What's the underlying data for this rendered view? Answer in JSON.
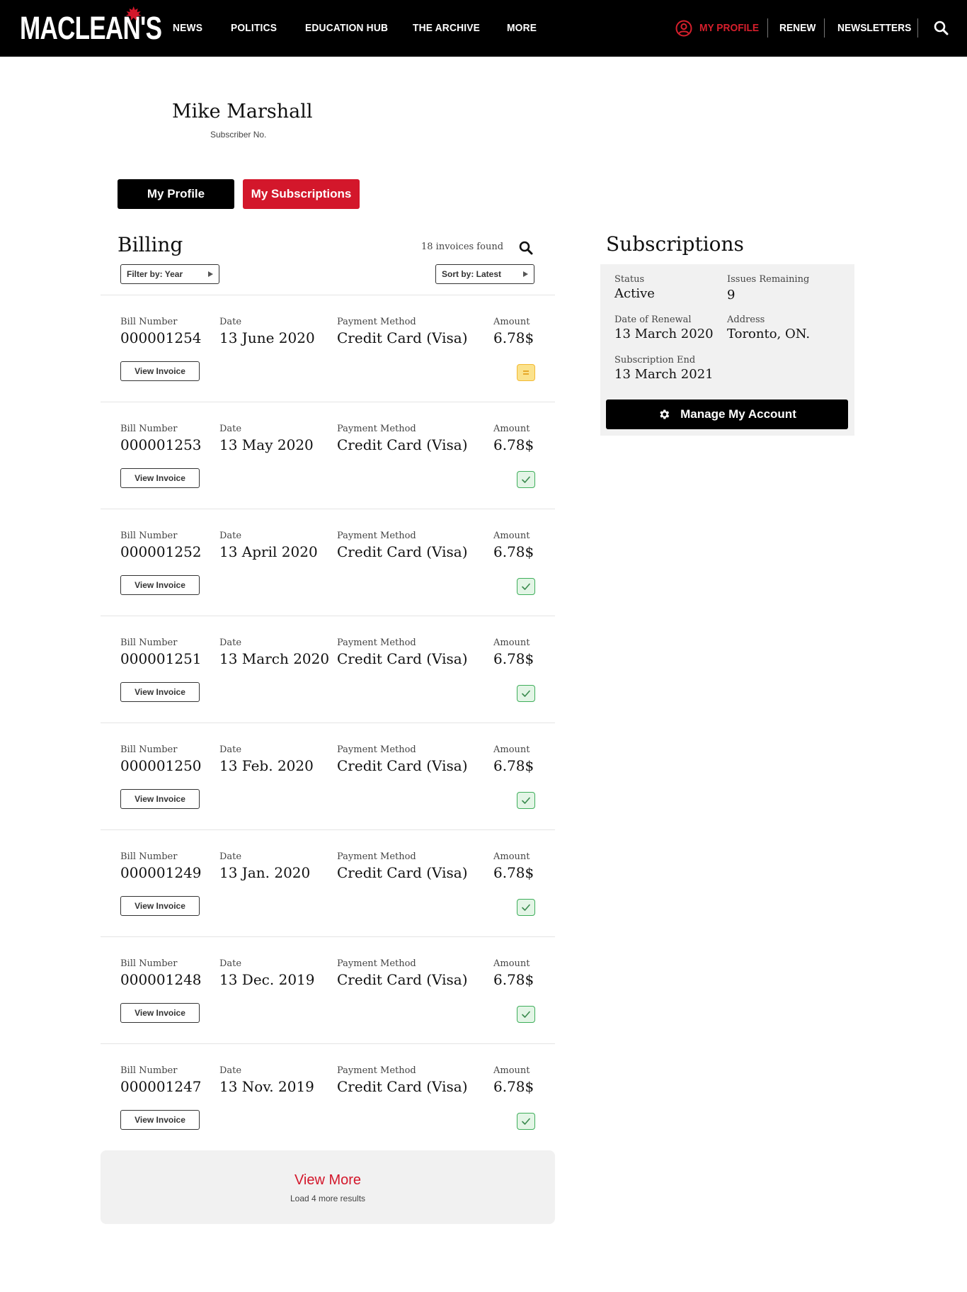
{
  "header": {
    "logo": "MACLEAN'S",
    "nav": [
      "NEWS",
      "POLITICS",
      "EDUCATION HUB",
      "THE ARCHIVE",
      "MORE"
    ],
    "my_profile": "MY PROFILE",
    "renew": "RENEW",
    "newsletters": "NEWSLETTERS",
    "brand_color": "#d3172b",
    "icons": {
      "profile": "user-circle-icon",
      "search": "search-icon",
      "logo_leaf": "maple-leaf-icon"
    }
  },
  "profile": {
    "name": "Mike Marshall",
    "subscriber_label": "Subscriber No."
  },
  "tabs": {
    "my_profile": "My Profile",
    "my_subscriptions": "My Subscriptions"
  },
  "billing": {
    "title": "Billing",
    "count_text": "18 invoices found",
    "filter_label": "Filter by: Year",
    "sort_label": "Sort by: Latest",
    "labels": {
      "bill_number": "Bill Number",
      "date": "Date",
      "payment_method": "Payment Method",
      "amount": "Amount",
      "view_invoice": "View Invoice"
    },
    "invoices": [
      {
        "bill_number": "000001254",
        "date": "13 June 2020",
        "payment_method": "Credit Card (Visa)",
        "amount": "6.78$",
        "status": "pending"
      },
      {
        "bill_number": "000001253",
        "date": "13 May 2020",
        "payment_method": "Credit Card (Visa)",
        "amount": "6.78$",
        "status": "paid"
      },
      {
        "bill_number": "000001252",
        "date": "13 April 2020",
        "payment_method": "Credit Card (Visa)",
        "amount": "6.78$",
        "status": "paid"
      },
      {
        "bill_number": "000001251",
        "date": "13 March 2020",
        "payment_method": "Credit Card (Visa)",
        "amount": "6.78$",
        "status": "paid"
      },
      {
        "bill_number": "000001250",
        "date": "13 Feb. 2020",
        "payment_method": "Credit Card (Visa)",
        "amount": "6.78$",
        "status": "paid"
      },
      {
        "bill_number": "000001249",
        "date": "13 Jan. 2020",
        "payment_method": "Credit Card (Visa)",
        "amount": "6.78$",
        "status": "paid"
      },
      {
        "bill_number": "000001248",
        "date": "13 Dec. 2019",
        "payment_method": "Credit Card (Visa)",
        "amount": "6.78$",
        "status": "paid"
      },
      {
        "bill_number": "000001247",
        "date": "13 Nov. 2019",
        "payment_method": "Credit Card (Visa)",
        "amount": "6.78$",
        "status": "paid"
      }
    ],
    "view_more": "View More",
    "view_more_sub": "Load 4 more results"
  },
  "subscriptions": {
    "title": "Subscriptions",
    "status_label": "Status",
    "status_value": "Active",
    "issues_label": "Issues Remaining",
    "issues_value": "9",
    "renewal_label": "Date of Renewal",
    "renewal_value": "13 March 2020",
    "address_label": "Address",
    "address_value": "Toronto, ON.",
    "end_label": "Subscription End",
    "end_value": "13 March 2021",
    "manage_button": "Manage My Account"
  }
}
